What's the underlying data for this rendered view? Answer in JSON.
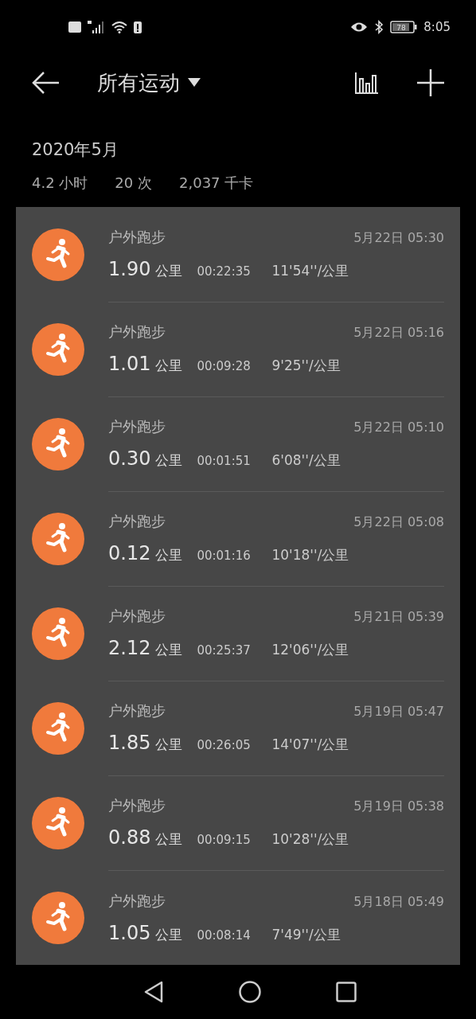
{
  "status_bar": {
    "time": "8:05",
    "battery": "78"
  },
  "header": {
    "title": "所有运动"
  },
  "summary": {
    "month": "2020年5月",
    "hours": "4.2 小时",
    "count": "20 次",
    "calories": "2,037 千卡"
  },
  "activities": [
    {
      "type": "户外跑步",
      "datetime": "5月22日 05:30",
      "distance": "1.90",
      "unit": "公里",
      "duration": "00:22:35",
      "pace": "11'54''/公里"
    },
    {
      "type": "户外跑步",
      "datetime": "5月22日 05:16",
      "distance": "1.01",
      "unit": "公里",
      "duration": "00:09:28",
      "pace": "9'25''/公里"
    },
    {
      "type": "户外跑步",
      "datetime": "5月22日 05:10",
      "distance": "0.30",
      "unit": "公里",
      "duration": "00:01:51",
      "pace": "6'08''/公里"
    },
    {
      "type": "户外跑步",
      "datetime": "5月22日 05:08",
      "distance": "0.12",
      "unit": "公里",
      "duration": "00:01:16",
      "pace": "10'18''/公里"
    },
    {
      "type": "户外跑步",
      "datetime": "5月21日 05:39",
      "distance": "2.12",
      "unit": "公里",
      "duration": "00:25:37",
      "pace": "12'06''/公里"
    },
    {
      "type": "户外跑步",
      "datetime": "5月19日 05:47",
      "distance": "1.85",
      "unit": "公里",
      "duration": "00:26:05",
      "pace": "14'07''/公里"
    },
    {
      "type": "户外跑步",
      "datetime": "5月19日 05:38",
      "distance": "0.88",
      "unit": "公里",
      "duration": "00:09:15",
      "pace": "10'28''/公里"
    },
    {
      "type": "户外跑步",
      "datetime": "5月18日 05:49",
      "distance": "1.05",
      "unit": "公里",
      "duration": "00:08:14",
      "pace": "7'49''/公里"
    }
  ]
}
